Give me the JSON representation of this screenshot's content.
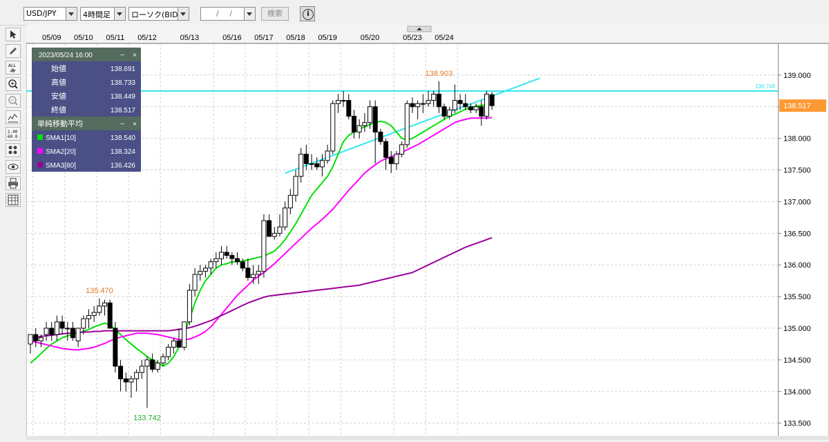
{
  "toolbar_top": {
    "symbol": "USD/JPY",
    "timeframe": "4時間足",
    "chart_type": "ローソク(BID)",
    "date": "/ /",
    "search_label": "検索",
    "info_icon": "info-icon"
  },
  "left_tools": [
    "cursor-icon",
    "pencil-icon",
    "eraser-all-icon",
    "zoom-in-icon",
    "zoom-out-icon",
    "indicator-icon",
    "ohlc-values-icon",
    "settings-icon",
    "eye-icon",
    "print-icon",
    "grid-table-icon"
  ],
  "info_panel": {
    "datetime": "2023/05/24 16:00",
    "rows": [
      {
        "label": "始値",
        "value": "138.691"
      },
      {
        "label": "高値",
        "value": "138.733"
      },
      {
        "label": "安値",
        "value": "138.449"
      },
      {
        "label": "終値",
        "value": "138.517"
      }
    ],
    "sma_title": "単純移動平均",
    "sma": [
      {
        "label": "SMA1[10]",
        "value": "138.540",
        "color": "#00e000"
      },
      {
        "label": "SMA2[20]",
        "value": "138.324",
        "color": "#ff00ff"
      },
      {
        "label": "SMA3[80]",
        "value": "136.426",
        "color": "#990099"
      }
    ]
  },
  "chart_data": {
    "type": "candlestick",
    "x_labels": [
      "05/09",
      "05/10",
      "05/11",
      "05/12",
      "05/13",
      "05/16",
      "05/17",
      "05/18",
      "05/19",
      "05/20",
      "05/23",
      "05/24"
    ],
    "y_ticks": [
      "139.000",
      "138.500",
      "138.000",
      "137.500",
      "137.000",
      "136.500",
      "136.000",
      "135.500",
      "135.000",
      "134.500",
      "134.000",
      "133.500"
    ],
    "ylim": [
      133.3,
      139.5
    ],
    "current_price": "138.517",
    "horizontal_line": {
      "value": 138.748,
      "label": "138.748",
      "color": "#33e6f0"
    },
    "trendline": {
      "from": [
        48,
        137.45
      ],
      "to": [
        96,
        138.95
      ],
      "color": "#33e6f0"
    },
    "annotations": [
      {
        "text": "135.470",
        "index": 13,
        "value": 135.47,
        "color": "#e87722"
      },
      {
        "text": "133.742",
        "index": 22,
        "value": 133.742,
        "color": "#22b022"
      },
      {
        "text": "138.903",
        "index": 77,
        "value": 138.903,
        "color": "#e87722"
      }
    ],
    "candles": [
      [
        134.75,
        134.9,
        134.6,
        134.9
      ],
      [
        134.9,
        135.0,
        134.7,
        134.8
      ],
      [
        134.8,
        134.9,
        134.7,
        134.85
      ],
      [
        134.9,
        135.1,
        134.8,
        135.0
      ],
      [
        135.0,
        135.1,
        134.8,
        134.9
      ],
      [
        134.9,
        135.2,
        134.8,
        135.1
      ],
      [
        135.1,
        135.2,
        134.9,
        135.0
      ],
      [
        135.0,
        135.1,
        134.8,
        135.0
      ],
      [
        135.0,
        135.1,
        134.8,
        134.85
      ],
      [
        134.8,
        135.0,
        134.7,
        135.0
      ],
      [
        135.0,
        135.2,
        134.9,
        135.15
      ],
      [
        135.15,
        135.3,
        135.0,
        135.2
      ],
      [
        135.2,
        135.35,
        135.1,
        135.25
      ],
      [
        135.25,
        135.47,
        135.2,
        135.35
      ],
      [
        135.35,
        135.45,
        135.2,
        135.4
      ],
      [
        135.4,
        135.45,
        135.0,
        135.0
      ],
      [
        135.0,
        135.1,
        134.3,
        134.4
      ],
      [
        134.4,
        134.5,
        134.0,
        134.2
      ],
      [
        134.2,
        134.3,
        134.0,
        134.15
      ],
      [
        134.15,
        134.25,
        133.9,
        134.2
      ],
      [
        134.2,
        134.35,
        134.0,
        134.3
      ],
      [
        134.3,
        134.5,
        134.2,
        134.4
      ],
      [
        134.4,
        134.55,
        133.742,
        134.5
      ],
      [
        134.5,
        134.6,
        134.3,
        134.35
      ],
      [
        134.35,
        134.5,
        134.3,
        134.45
      ],
      [
        134.45,
        134.6,
        134.4,
        134.55
      ],
      [
        134.55,
        134.75,
        134.5,
        134.7
      ],
      [
        134.7,
        134.85,
        134.6,
        134.8
      ],
      [
        134.8,
        135.0,
        134.7,
        134.7
      ],
      [
        134.7,
        135.1,
        134.65,
        135.1
      ],
      [
        135.1,
        135.7,
        135.05,
        135.6
      ],
      [
        135.6,
        135.95,
        135.5,
        135.85
      ],
      [
        135.85,
        136.0,
        135.75,
        135.9
      ],
      [
        135.9,
        136.0,
        135.8,
        135.95
      ],
      [
        135.95,
        136.1,
        135.85,
        136.05
      ],
      [
        136.05,
        136.2,
        135.95,
        136.1
      ],
      [
        136.1,
        136.3,
        136.0,
        136.2
      ],
      [
        136.2,
        136.3,
        136.1,
        136.15
      ],
      [
        136.15,
        136.2,
        136.0,
        136.1
      ],
      [
        136.1,
        136.2,
        136.0,
        136.05
      ],
      [
        136.05,
        136.1,
        135.9,
        135.95
      ],
      [
        135.95,
        136.1,
        135.75,
        135.8
      ],
      [
        135.8,
        136.0,
        135.7,
        135.85
      ],
      [
        135.85,
        136.0,
        135.7,
        135.9
      ],
      [
        135.9,
        136.8,
        135.8,
        136.7
      ],
      [
        136.7,
        136.8,
        136.5,
        136.45
      ],
      [
        136.45,
        136.6,
        136.4,
        136.5
      ],
      [
        136.5,
        136.8,
        136.45,
        136.6
      ],
      [
        136.6,
        137.0,
        136.55,
        136.9
      ],
      [
        136.9,
        137.2,
        136.8,
        137.1
      ],
      [
        137.1,
        137.5,
        137.0,
        137.4
      ],
      [
        137.4,
        137.85,
        137.3,
        137.75
      ],
      [
        137.75,
        137.9,
        137.5,
        137.6
      ],
      [
        137.6,
        137.75,
        137.5,
        137.6
      ],
      [
        137.6,
        137.7,
        137.5,
        137.55
      ],
      [
        137.55,
        137.75,
        137.4,
        137.65
      ],
      [
        137.65,
        137.9,
        137.6,
        137.8
      ],
      [
        137.8,
        138.6,
        137.75,
        138.55
      ],
      [
        138.55,
        138.7,
        138.4,
        138.6
      ],
      [
        138.6,
        138.75,
        138.5,
        138.6
      ],
      [
        138.6,
        138.7,
        138.3,
        138.35
      ],
      [
        138.35,
        138.45,
        138.0,
        138.1
      ],
      [
        138.1,
        138.3,
        138.0,
        138.2
      ],
      [
        138.2,
        138.4,
        138.1,
        138.25
      ],
      [
        138.25,
        138.6,
        138.15,
        138.5
      ],
      [
        138.5,
        138.6,
        137.6,
        138.1
      ],
      [
        138.1,
        138.15,
        137.9,
        137.95
      ],
      [
        137.95,
        138.0,
        137.5,
        137.7
      ],
      [
        137.7,
        137.8,
        137.45,
        137.6
      ],
      [
        137.6,
        137.8,
        137.5,
        137.75
      ],
      [
        137.75,
        137.95,
        137.7,
        137.9
      ],
      [
        137.9,
        138.6,
        137.85,
        138.55
      ],
      [
        138.55,
        138.65,
        138.4,
        138.5
      ],
      [
        138.5,
        138.6,
        138.3,
        138.55
      ],
      [
        138.55,
        138.7,
        138.4,
        138.55
      ],
      [
        138.55,
        138.75,
        138.5,
        138.6
      ],
      [
        138.6,
        138.75,
        138.5,
        138.7
      ],
      [
        138.7,
        138.903,
        138.4,
        138.5
      ],
      [
        138.5,
        138.55,
        138.3,
        138.35
      ],
      [
        138.35,
        138.5,
        138.3,
        138.45
      ],
      [
        138.45,
        138.85,
        138.4,
        138.6
      ],
      [
        138.6,
        138.7,
        138.45,
        138.55
      ],
      [
        138.55,
        138.7,
        138.45,
        138.5
      ],
      [
        138.5,
        138.55,
        138.4,
        138.45
      ],
      [
        138.45,
        138.55,
        138.4,
        138.5
      ],
      [
        138.5,
        138.6,
        138.2,
        138.35
      ],
      [
        138.35,
        138.75,
        138.3,
        138.7
      ],
      [
        138.691,
        138.733,
        138.449,
        138.517
      ]
    ],
    "series": [
      {
        "name": "SMA1[10]",
        "color": "#00e000",
        "values": [
          134.45,
          134.52,
          134.6,
          134.68,
          134.75,
          134.8,
          134.85,
          134.88,
          134.9,
          134.92,
          134.95,
          134.98,
          135.02,
          135.05,
          135.08,
          135.05,
          134.98,
          134.9,
          134.82,
          134.75,
          134.68,
          134.62,
          134.55,
          134.5,
          134.45,
          134.4,
          134.45,
          134.55,
          134.7,
          134.9,
          135.15,
          135.4,
          135.6,
          135.75,
          135.85,
          135.95,
          136.0,
          136.02,
          136.05,
          136.05,
          136.06,
          136.08,
          136.1,
          136.12,
          136.14,
          136.18,
          136.22,
          136.3,
          136.4,
          136.52,
          136.65,
          136.8,
          136.95,
          137.1,
          137.2,
          137.3,
          137.4,
          137.55,
          137.75,
          137.95,
          138.05,
          138.1,
          138.15,
          138.18,
          138.22,
          138.25,
          138.27,
          138.25,
          138.2,
          138.1,
          138.0,
          137.98,
          138.0,
          138.05,
          138.1,
          138.15,
          138.2,
          138.25,
          138.3,
          138.35,
          138.38,
          138.42,
          138.46,
          138.49,
          138.51,
          138.52,
          138.53,
          138.54
        ]
      },
      {
        "name": "SMA2[20]",
        "color": "#ff00ff",
        "values": [
          134.8,
          134.78,
          134.76,
          134.74,
          134.72,
          134.7,
          134.68,
          134.67,
          134.66,
          134.66,
          134.67,
          134.68,
          134.7,
          134.73,
          134.76,
          134.8,
          134.83,
          134.86,
          134.88,
          134.9,
          134.92,
          134.92,
          134.92,
          134.91,
          134.9,
          134.88,
          134.86,
          134.84,
          134.82,
          134.82,
          134.83,
          134.86,
          134.9,
          134.95,
          135.02,
          135.12,
          135.22,
          135.32,
          135.42,
          135.52,
          135.6,
          135.68,
          135.76,
          135.82,
          135.88,
          135.95,
          136.02,
          136.1,
          136.18,
          136.26,
          136.34,
          136.42,
          136.5,
          136.58,
          136.65,
          136.72,
          136.8,
          136.88,
          136.98,
          137.08,
          137.18,
          137.27,
          137.36,
          137.45,
          137.52,
          137.58,
          137.64,
          137.68,
          137.71,
          137.74,
          137.78,
          137.82,
          137.86,
          137.9,
          137.95,
          138.0,
          138.05,
          138.1,
          138.15,
          138.2,
          138.25,
          138.28,
          138.3,
          138.32,
          138.32,
          138.32,
          138.32,
          138.33
        ]
      },
      {
        "name": "SMA3[80]",
        "color": "#990099",
        "values": [
          134.85,
          134.86,
          134.87,
          134.88,
          134.89,
          134.9,
          134.91,
          134.92,
          134.92,
          134.93,
          134.94,
          134.94,
          134.95,
          134.95,
          134.96,
          134.96,
          134.96,
          134.96,
          134.96,
          134.96,
          134.96,
          134.96,
          134.96,
          134.96,
          134.96,
          134.96,
          134.96,
          134.97,
          134.98,
          134.99,
          135.01,
          135.03,
          135.06,
          135.09,
          135.12,
          135.16,
          135.2,
          135.24,
          135.28,
          135.32,
          135.36,
          135.4,
          135.43,
          135.46,
          135.49,
          135.51,
          135.52,
          135.53,
          135.54,
          135.55,
          135.56,
          135.57,
          135.58,
          135.59,
          135.6,
          135.61,
          135.62,
          135.63,
          135.64,
          135.65,
          135.66,
          135.67,
          135.68,
          135.7,
          135.72,
          135.74,
          135.76,
          135.78,
          135.8,
          135.82,
          135.84,
          135.86,
          135.88,
          135.92,
          135.96,
          136.0,
          136.04,
          136.08,
          136.12,
          136.16,
          136.2,
          136.24,
          136.28,
          136.31,
          136.34,
          136.37,
          136.4,
          136.43
        ]
      }
    ]
  }
}
